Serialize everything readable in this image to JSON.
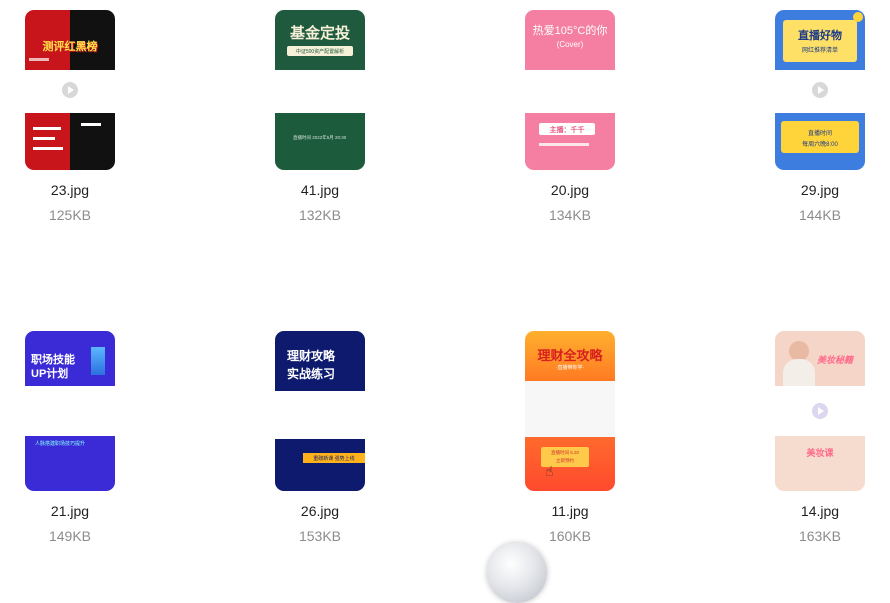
{
  "files": [
    {
      "name": "23.jpg",
      "size": "125KB",
      "title": "测评红黑榜"
    },
    {
      "name": "41.jpg",
      "size": "132KB",
      "title": "基金定投",
      "subtitle": "中证500资产配置解析",
      "footer": "直播时间 2022年5月 20:30"
    },
    {
      "name": "20.jpg",
      "size": "134KB",
      "title": "热爱105°C的你",
      "subtitle": "(Cover)",
      "host": "主播：千千"
    },
    {
      "name": "29.jpg",
      "size": "144KB",
      "title": "直播好物",
      "subtitle": "网红推荐清单",
      "bottom_line1": "直播时间",
      "bottom_line2": "每周六晚8:00"
    },
    {
      "name": "21.jpg",
      "size": "149KB",
      "title_line1": "职场技能",
      "title_line2": "UP计划",
      "footer": "人脉搭建职场技巧提升"
    },
    {
      "name": "26.jpg",
      "size": "153KB",
      "title_line1": "理财攻略",
      "title_line2": "实战练习",
      "footer": "重磅新课 强势上线"
    },
    {
      "name": "11.jpg",
      "size": "160KB",
      "title": "理财全攻略",
      "subtitle": "·直播带你学·",
      "box_line1": "直播时间 5.20",
      "box_line2": "立即预约"
    },
    {
      "name": "14.jpg",
      "size": "163KB",
      "title": "美妆秘籍",
      "footer": "美妆课"
    }
  ],
  "colors": {
    "filename": "#222222",
    "filesize": "#8c8c8c"
  }
}
